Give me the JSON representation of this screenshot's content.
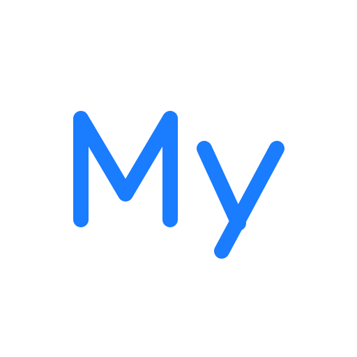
{
  "logo": {
    "text": "My",
    "color": "#1a7cff",
    "background": "#ffffff"
  }
}
